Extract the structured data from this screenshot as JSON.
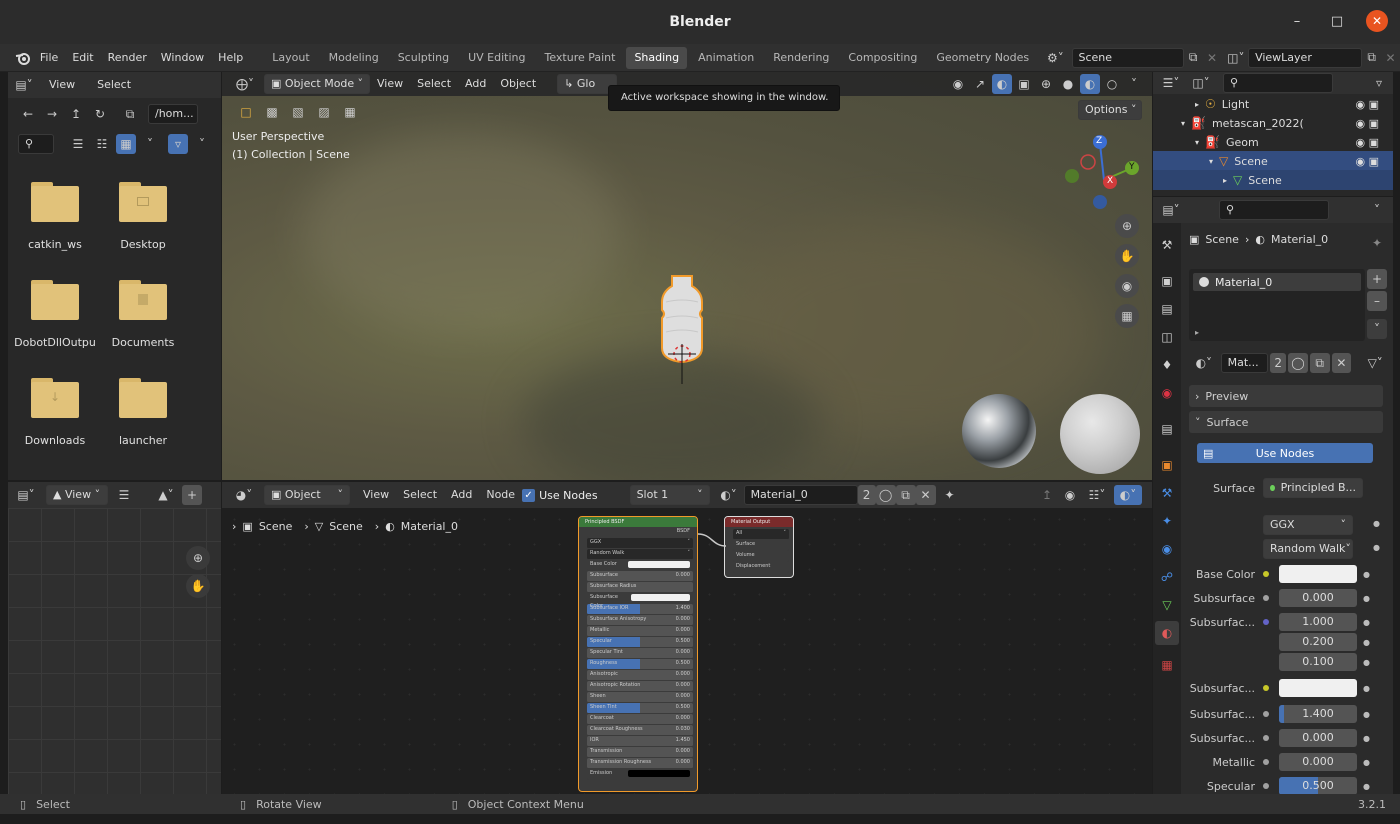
{
  "window": {
    "title": "Blender"
  },
  "menu": [
    "File",
    "Edit",
    "Render",
    "Window",
    "Help"
  ],
  "workspaces": [
    "Layout",
    "Modeling",
    "Sculpting",
    "UV Editing",
    "Texture Paint",
    "Shading",
    "Animation",
    "Rendering",
    "Compositing",
    "Geometry Nodes"
  ],
  "active_workspace": "Shading",
  "scene_field": "Scene",
  "viewlayer_field": "ViewLayer",
  "tooltip": "Active workspace showing in the window.",
  "filebrowser": {
    "menus": [
      "View",
      "Select"
    ],
    "path": "/hom...",
    "folders": [
      "catkin_ws",
      "Desktop",
      "DobotDllOutpu",
      "Documents",
      "Downloads",
      "launcher"
    ]
  },
  "viewport": {
    "mode": "Object Mode",
    "menus": [
      "View",
      "Select",
      "Add",
      "Object"
    ],
    "transform": "Glo",
    "view_label": "User Perspective",
    "collection_label": "(1) Collection | Scene",
    "options": "Options",
    "axes": {
      "z": "Z",
      "y": "Y",
      "x": "X"
    }
  },
  "nodeeditor": {
    "left_menus": [
      "View"
    ],
    "type": "Object",
    "menus": [
      "View",
      "Select",
      "Add",
      "Node"
    ],
    "use_nodes": "Use Nodes",
    "slot": "Slot 1",
    "material": "Material_0",
    "users": "2",
    "breadcrumb": [
      "Scene",
      "Scene",
      "Material_0"
    ],
    "principled": {
      "title": "Principled BSDF",
      "output": "BSDF",
      "dist": "GGX",
      "sss": "Random Walk",
      "rows": [
        {
          "label": "Base Color",
          "value": ""
        },
        {
          "label": "Subsurface",
          "value": "0.000"
        },
        {
          "label": "Subsurface Radius",
          "value": ""
        },
        {
          "label": "Subsurface Color",
          "value": ""
        },
        {
          "label": "Subsurface IOR",
          "value": "1.400"
        },
        {
          "label": "Subsurface Anisotropy",
          "value": "0.000"
        },
        {
          "label": "Metallic",
          "value": "0.000"
        },
        {
          "label": "Specular",
          "value": "0.500"
        },
        {
          "label": "Specular Tint",
          "value": "0.000"
        },
        {
          "label": "Roughness",
          "value": "0.500"
        },
        {
          "label": "Anisotropic",
          "value": "0.000"
        },
        {
          "label": "Anisotropic Rotation",
          "value": "0.000"
        },
        {
          "label": "Sheen",
          "value": "0.000"
        },
        {
          "label": "Sheen Tint",
          "value": "0.500"
        },
        {
          "label": "Clearcoat",
          "value": "0.000"
        },
        {
          "label": "Clearcoat Roughness",
          "value": "0.030"
        },
        {
          "label": "IOR",
          "value": "1.450"
        },
        {
          "label": "Transmission",
          "value": "0.000"
        },
        {
          "label": "Transmission Roughness",
          "value": "0.000"
        },
        {
          "label": "Emission",
          "value": ""
        }
      ]
    },
    "output_node": {
      "title": "Material Output",
      "target": "All",
      "sockets": [
        "Surface",
        "Volume",
        "Displacement"
      ]
    }
  },
  "outliner": {
    "rows": [
      {
        "label": "Light",
        "indent": 3
      },
      {
        "label": "metascan_2022(",
        "indent": 2
      },
      {
        "label": "Geom",
        "indent": 3
      },
      {
        "label": "Scene",
        "indent": 4
      },
      {
        "label": "Scene",
        "indent": 5
      }
    ]
  },
  "properties": {
    "breadcrumb_scene": "Scene",
    "breadcrumb_material": "Material_0",
    "slot_item": "Material_0",
    "mat_field": "Mat...",
    "mat_users": "2",
    "panels": {
      "preview": "Preview",
      "surface": "Surface"
    },
    "use_nodes": "Use Nodes",
    "surface_label": "Surface",
    "surface_value": "Principled B...",
    "dist": "GGX",
    "sss": "Random Walk",
    "rows": [
      {
        "label": "Base Color",
        "value": "",
        "dot": "#c7c729",
        "white": true
      },
      {
        "label": "Subsurface",
        "value": "0.000",
        "dot": "#a1a1a1"
      },
      {
        "label": "Subsurfac...",
        "value": "1.000",
        "dot": "#6363c7"
      },
      {
        "label": "",
        "value": "0.200"
      },
      {
        "label": "",
        "value": "0.100"
      },
      {
        "label": "Subsurfac...",
        "value": "",
        "dot": "#c7c729",
        "white": true
      },
      {
        "label": "Subsurfac...",
        "value": "1.400",
        "dot": "#a1a1a1",
        "fill": 0.06
      },
      {
        "label": "Subsurfac...",
        "value": "0.000",
        "dot": "#a1a1a1"
      },
      {
        "label": "Metallic",
        "value": "0.000",
        "dot": "#a1a1a1"
      },
      {
        "label": "Specular",
        "value": "0.500",
        "dot": "#a1a1a1",
        "fill": 0.5
      }
    ]
  },
  "statusbar": {
    "select": "Select",
    "rotate": "Rotate View",
    "context": "Object Context Menu",
    "version": "3.2.1"
  }
}
